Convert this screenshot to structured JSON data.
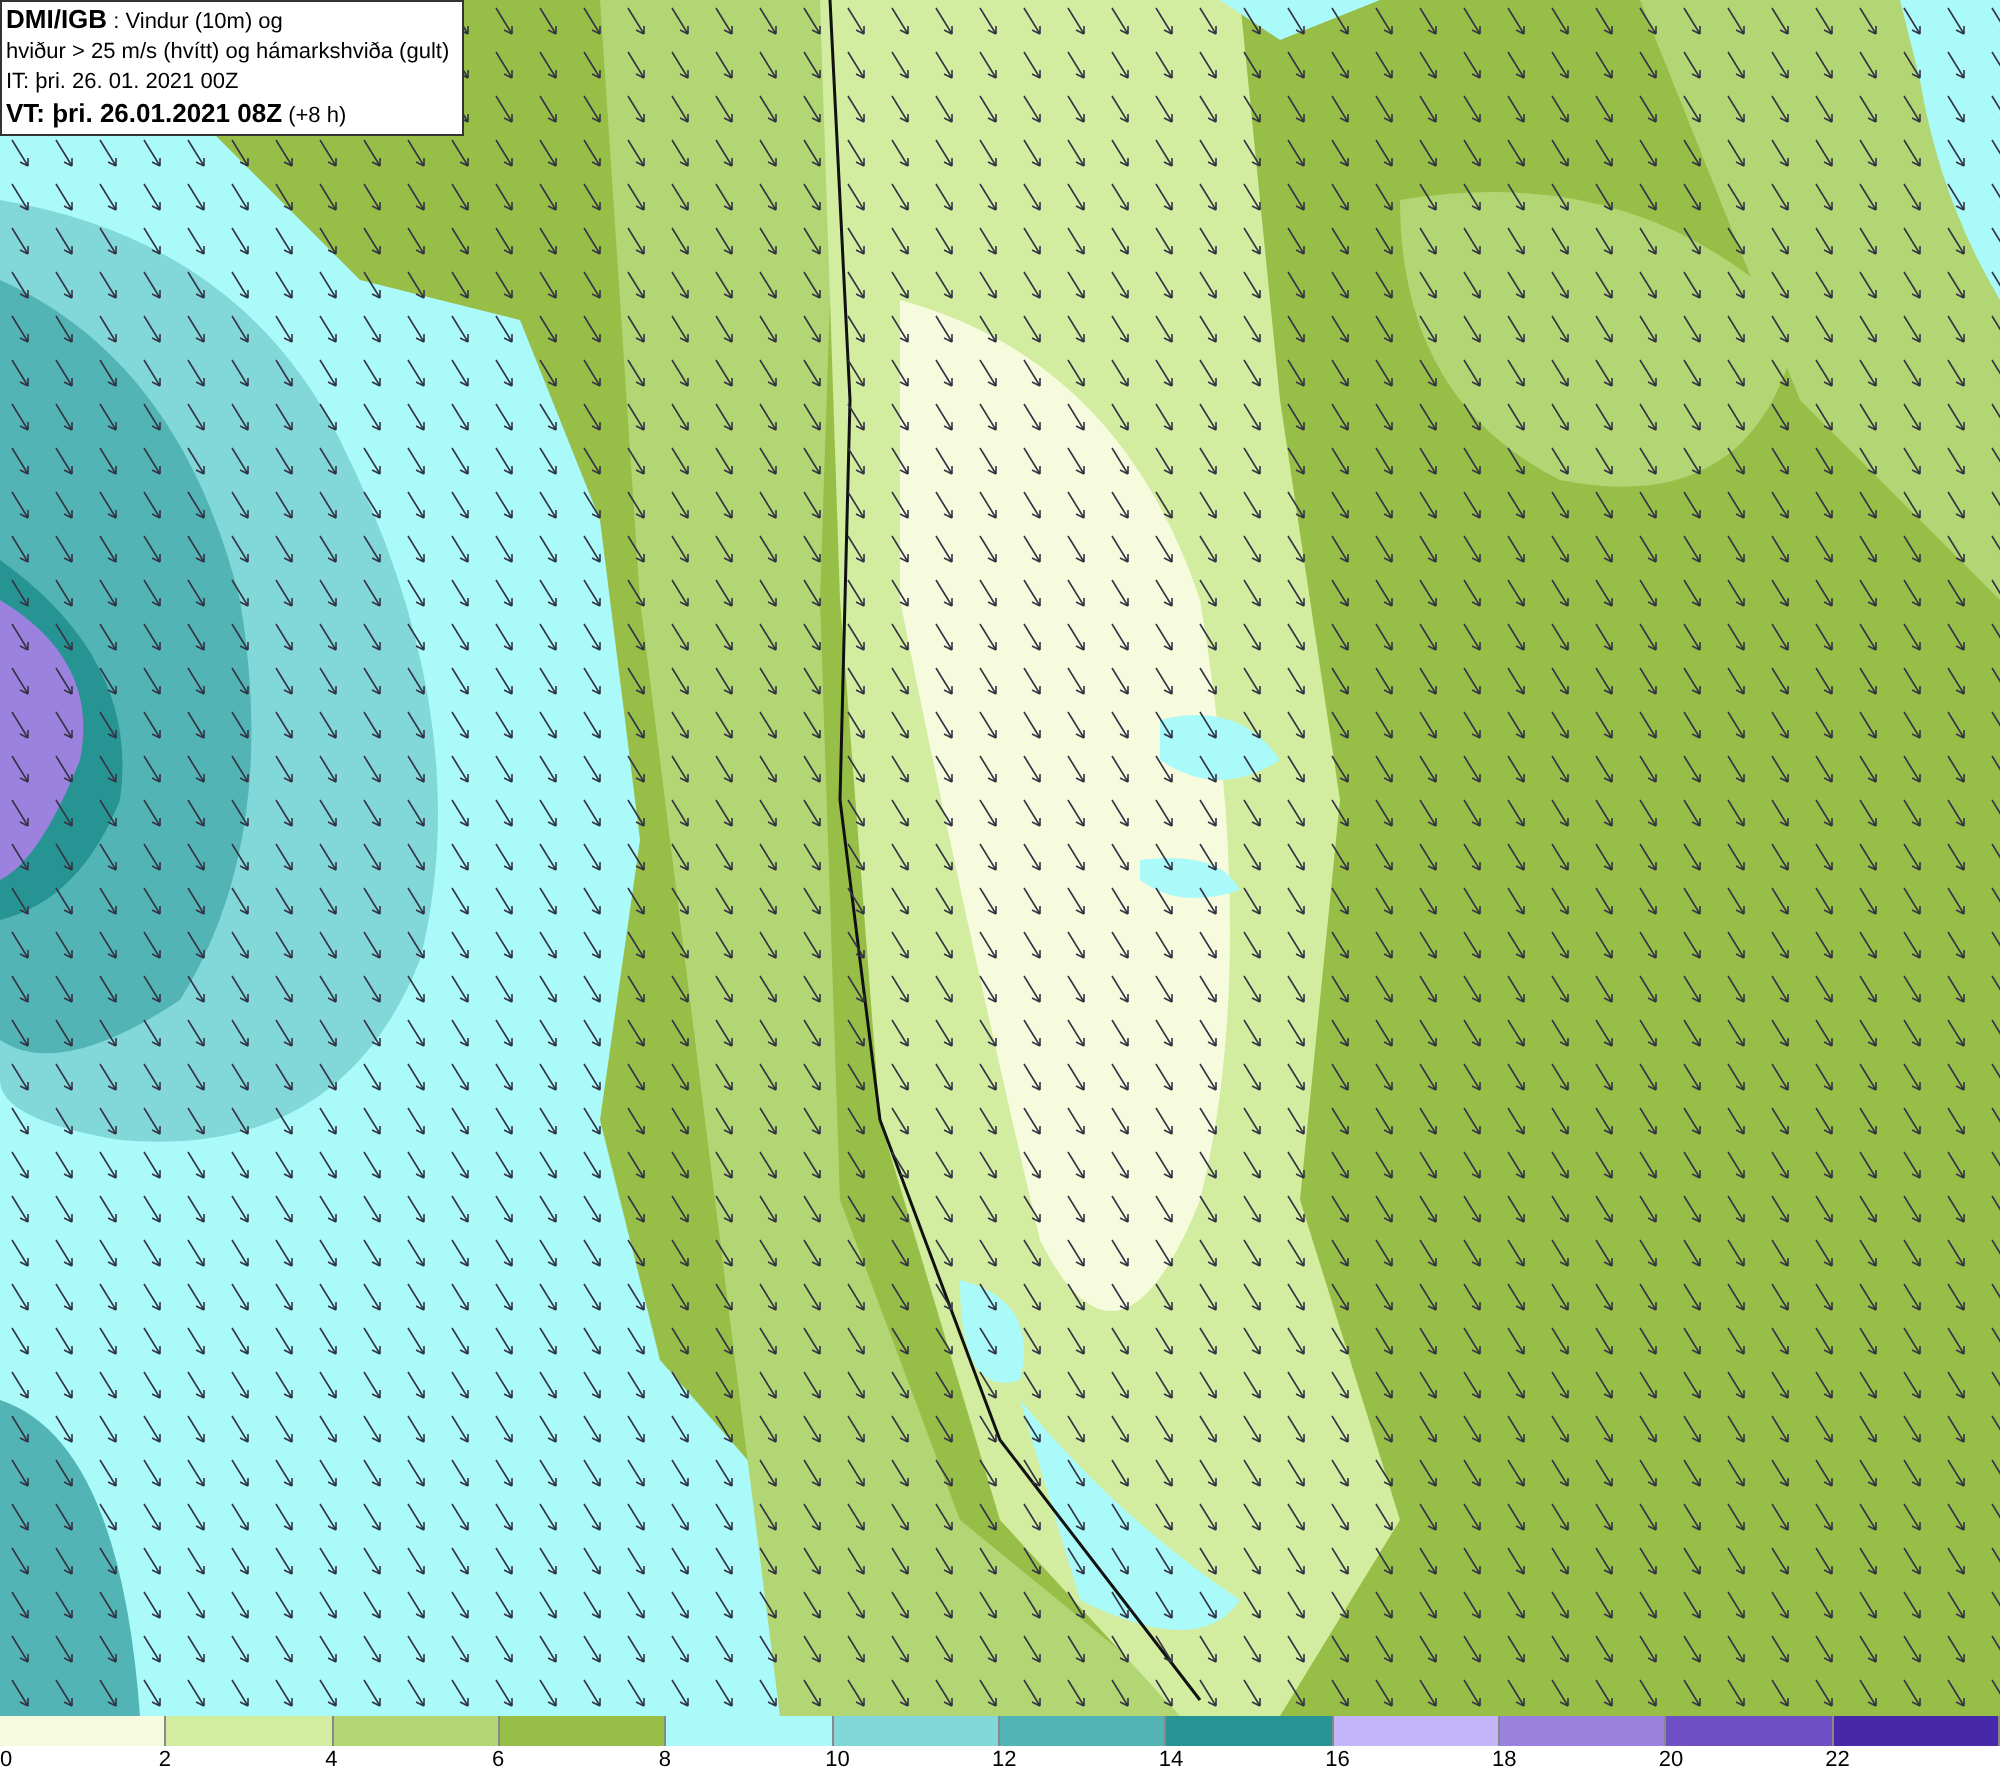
{
  "info_box": {
    "lines": [
      "**DMI/IGB** : Vindur (10m) og",
      "hviður > 25 m/s (hvítt) og hámarkshviða (gult)",
      "IT: þri. 26. 01. 2021 00Z",
      "**VT: þri. 26.01.2021 08Z** (+8 h)"
    ]
  },
  "legend": [
    {
      "label": "0",
      "color": "#f5fbdc"
    },
    {
      "label": "2",
      "color": "#d3eda0"
    },
    {
      "label": "4",
      "color": "#b2d673"
    },
    {
      "label": "6",
      "color": "#97be47"
    },
    {
      "label": "8",
      "color": "#aafafa"
    },
    {
      "label": "10",
      "color": "#82d8d8"
    },
    {
      "label": "12",
      "color": "#52b4b4"
    },
    {
      "label": "14",
      "color": "#279494"
    },
    {
      "label": "16",
      "color": "#c4b4fa"
    },
    {
      "label": "18",
      "color": "#9a82de"
    },
    {
      "label": "20",
      "color": "#6e50c4"
    },
    {
      "label": "22",
      "color": "#4628a8"
    }
  ]
}
